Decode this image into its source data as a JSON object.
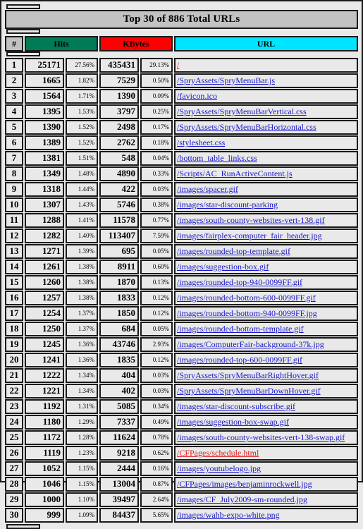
{
  "report": {
    "title": "Top 30 of 886 Total URLs",
    "columns": {
      "number": "#",
      "hits": "Hits",
      "kbytes": "KBytes",
      "url": "URL"
    },
    "colors": {
      "hits_header_bg": "#007b55",
      "kbytes_header_bg": "#fe0000",
      "url_header_bg": "#00e5ff",
      "title_bg": "#c2c2c2",
      "row_bg": "#e9e9e9",
      "link_blue": "#1818c8",
      "link_red": "#e02020",
      "border": "#1a1a1a"
    },
    "rows": [
      {
        "n": "1",
        "hits": "25171",
        "hits_pct": "27.56%",
        "kbytes": "435431",
        "kbytes_pct": "29.13%",
        "url": "/",
        "link_color": "red"
      },
      {
        "n": "2",
        "hits": "1665",
        "hits_pct": "1.82%",
        "kbytes": "7529",
        "kbytes_pct": "0.50%",
        "url": "/SpryAssets/SpryMenuBar.js",
        "link_color": "blue"
      },
      {
        "n": "3",
        "hits": "1564",
        "hits_pct": "1.71%",
        "kbytes": "1390",
        "kbytes_pct": "0.09%",
        "url": "/favicon.ico",
        "link_color": "blue"
      },
      {
        "n": "4",
        "hits": "1395",
        "hits_pct": "1.53%",
        "kbytes": "3797",
        "kbytes_pct": "0.25%",
        "url": "/SpryAssets/SpryMenuBarVertical.css",
        "link_color": "blue"
      },
      {
        "n": "5",
        "hits": "1390",
        "hits_pct": "1.52%",
        "kbytes": "2498",
        "kbytes_pct": "0.17%",
        "url": "/SpryAssets/SpryMenuBarHorizontal.css",
        "link_color": "blue"
      },
      {
        "n": "6",
        "hits": "1389",
        "hits_pct": "1.52%",
        "kbytes": "2762",
        "kbytes_pct": "0.18%",
        "url": "/stylesheet.css",
        "link_color": "blue"
      },
      {
        "n": "7",
        "hits": "1381",
        "hits_pct": "1.51%",
        "kbytes": "548",
        "kbytes_pct": "0.04%",
        "url": "/bottom_table_links.css",
        "link_color": "blue"
      },
      {
        "n": "8",
        "hits": "1349",
        "hits_pct": "1.48%",
        "kbytes": "4890",
        "kbytes_pct": "0.33%",
        "url": "/Scripts/AC_RunActiveContent.js",
        "link_color": "blue"
      },
      {
        "n": "9",
        "hits": "1318",
        "hits_pct": "1.44%",
        "kbytes": "422",
        "kbytes_pct": "0.03%",
        "url": "/images/spacer.gif",
        "link_color": "blue"
      },
      {
        "n": "10",
        "hits": "1307",
        "hits_pct": "1.43%",
        "kbytes": "5746",
        "kbytes_pct": "0.38%",
        "url": "/images/star-discount-parking",
        "link_color": "blue"
      },
      {
        "n": "11",
        "hits": "1288",
        "hits_pct": "1.41%",
        "kbytes": "11578",
        "kbytes_pct": "0.77%",
        "url": "/images/south-county-websites-vert-138.gif",
        "link_color": "blue"
      },
      {
        "n": "12",
        "hits": "1282",
        "hits_pct": "1.40%",
        "kbytes": "113407",
        "kbytes_pct": "7.59%",
        "url": "/images/fairplex-computer_fair_header.jpg",
        "link_color": "blue"
      },
      {
        "n": "13",
        "hits": "1271",
        "hits_pct": "1.39%",
        "kbytes": "695",
        "kbytes_pct": "0.05%",
        "url": "/images/rounded-top-template.gif",
        "link_color": "blue"
      },
      {
        "n": "14",
        "hits": "1261",
        "hits_pct": "1.38%",
        "kbytes": "8911",
        "kbytes_pct": "0.60%",
        "url": "/images/suggestion-box.gif",
        "link_color": "blue"
      },
      {
        "n": "15",
        "hits": "1260",
        "hits_pct": "1.38%",
        "kbytes": "1870",
        "kbytes_pct": "0.13%",
        "url": "/images/rounded-top-940-0099FF.gif",
        "link_color": "blue"
      },
      {
        "n": "16",
        "hits": "1257",
        "hits_pct": "1.38%",
        "kbytes": "1833",
        "kbytes_pct": "0.12%",
        "url": "/images/rounded-bottom-600-0099FF.gif",
        "link_color": "blue"
      },
      {
        "n": "17",
        "hits": "1254",
        "hits_pct": "1.37%",
        "kbytes": "1850",
        "kbytes_pct": "0.12%",
        "url": "/images/rounded-bottom-940-0099FF.jpg",
        "link_color": "blue"
      },
      {
        "n": "18",
        "hits": "1250",
        "hits_pct": "1.37%",
        "kbytes": "684",
        "kbytes_pct": "0.05%",
        "url": "/images/rounded-bottom-template.gif",
        "link_color": "blue"
      },
      {
        "n": "19",
        "hits": "1245",
        "hits_pct": "1.36%",
        "kbytes": "43746",
        "kbytes_pct": "2.93%",
        "url": "/images/ComputerFair-background-37k.jpg",
        "link_color": "blue"
      },
      {
        "n": "20",
        "hits": "1241",
        "hits_pct": "1.36%",
        "kbytes": "1835",
        "kbytes_pct": "0.12%",
        "url": "/images/rounded-top-600-0099FF.gif",
        "link_color": "blue"
      },
      {
        "n": "21",
        "hits": "1222",
        "hits_pct": "1.34%",
        "kbytes": "404",
        "kbytes_pct": "0.03%",
        "url": "/SpryAssets/SpryMenuBarRightHover.gif",
        "link_color": "blue"
      },
      {
        "n": "22",
        "hits": "1221",
        "hits_pct": "1.34%",
        "kbytes": "402",
        "kbytes_pct": "0.03%",
        "url": "/SpryAssets/SpryMenuBarDownHover.gif",
        "link_color": "blue"
      },
      {
        "n": "23",
        "hits": "1192",
        "hits_pct": "1.31%",
        "kbytes": "5085",
        "kbytes_pct": "0.34%",
        "url": "/images/star-discount-subscribe.gif",
        "link_color": "blue"
      },
      {
        "n": "24",
        "hits": "1180",
        "hits_pct": "1.29%",
        "kbytes": "7337",
        "kbytes_pct": "0.49%",
        "url": "/images/suggestion-box-swap.gif",
        "link_color": "blue"
      },
      {
        "n": "25",
        "hits": "1172",
        "hits_pct": "1.28%",
        "kbytes": "11624",
        "kbytes_pct": "0.78%",
        "url": "/images/south-county-websites-vert-138-swap.gif",
        "link_color": "blue"
      },
      {
        "n": "26",
        "hits": "1119",
        "hits_pct": "1.23%",
        "kbytes": "9218",
        "kbytes_pct": "0.62%",
        "url": "/CFPages/schedule.html",
        "link_color": "red"
      },
      {
        "n": "27",
        "hits": "1052",
        "hits_pct": "1.15%",
        "kbytes": "2444",
        "kbytes_pct": "0.16%",
        "url": "/images/youtubelogo.jpg",
        "link_color": "blue"
      },
      {
        "n": "28",
        "hits": "1046",
        "hits_pct": "1.15%",
        "kbytes": "13004",
        "kbytes_pct": "0.87%",
        "url": "/CFPages/images/benjaminrockwell.jpg",
        "link_color": "blue"
      },
      {
        "n": "29",
        "hits": "1000",
        "hits_pct": "1.10%",
        "kbytes": "39497",
        "kbytes_pct": "2.64%",
        "url": "/images/CF_July2009-sm-rounded.jpg",
        "link_color": "blue"
      },
      {
        "n": "30",
        "hits": "999",
        "hits_pct": "1.09%",
        "kbytes": "84437",
        "kbytes_pct": "5.65%",
        "url": "/images/wahb-expo-white.png",
        "link_color": "blue"
      }
    ]
  }
}
